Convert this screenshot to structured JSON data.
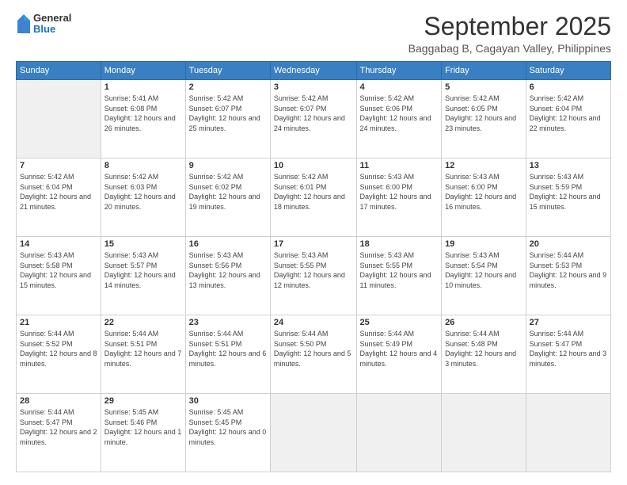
{
  "logo": {
    "general": "General",
    "blue": "Blue"
  },
  "header": {
    "month_title": "September 2025",
    "subtitle": "Baggabag B, Cagayan Valley, Philippines"
  },
  "weekdays": [
    "Sunday",
    "Monday",
    "Tuesday",
    "Wednesday",
    "Thursday",
    "Friday",
    "Saturday"
  ],
  "weeks": [
    [
      {
        "day": "",
        "empty": true
      },
      {
        "day": "1",
        "sunrise": "Sunrise: 5:41 AM",
        "sunset": "Sunset: 6:08 PM",
        "daylight": "Daylight: 12 hours and 26 minutes."
      },
      {
        "day": "2",
        "sunrise": "Sunrise: 5:42 AM",
        "sunset": "Sunset: 6:07 PM",
        "daylight": "Daylight: 12 hours and 25 minutes."
      },
      {
        "day": "3",
        "sunrise": "Sunrise: 5:42 AM",
        "sunset": "Sunset: 6:07 PM",
        "daylight": "Daylight: 12 hours and 24 minutes."
      },
      {
        "day": "4",
        "sunrise": "Sunrise: 5:42 AM",
        "sunset": "Sunset: 6:06 PM",
        "daylight": "Daylight: 12 hours and 24 minutes."
      },
      {
        "day": "5",
        "sunrise": "Sunrise: 5:42 AM",
        "sunset": "Sunset: 6:05 PM",
        "daylight": "Daylight: 12 hours and 23 minutes."
      },
      {
        "day": "6",
        "sunrise": "Sunrise: 5:42 AM",
        "sunset": "Sunset: 6:04 PM",
        "daylight": "Daylight: 12 hours and 22 minutes."
      }
    ],
    [
      {
        "day": "7",
        "sunrise": "Sunrise: 5:42 AM",
        "sunset": "Sunset: 6:04 PM",
        "daylight": "Daylight: 12 hours and 21 minutes."
      },
      {
        "day": "8",
        "sunrise": "Sunrise: 5:42 AM",
        "sunset": "Sunset: 6:03 PM",
        "daylight": "Daylight: 12 hours and 20 minutes."
      },
      {
        "day": "9",
        "sunrise": "Sunrise: 5:42 AM",
        "sunset": "Sunset: 6:02 PM",
        "daylight": "Daylight: 12 hours and 19 minutes."
      },
      {
        "day": "10",
        "sunrise": "Sunrise: 5:42 AM",
        "sunset": "Sunset: 6:01 PM",
        "daylight": "Daylight: 12 hours and 18 minutes."
      },
      {
        "day": "11",
        "sunrise": "Sunrise: 5:43 AM",
        "sunset": "Sunset: 6:00 PM",
        "daylight": "Daylight: 12 hours and 17 minutes."
      },
      {
        "day": "12",
        "sunrise": "Sunrise: 5:43 AM",
        "sunset": "Sunset: 6:00 PM",
        "daylight": "Daylight: 12 hours and 16 minutes."
      },
      {
        "day": "13",
        "sunrise": "Sunrise: 5:43 AM",
        "sunset": "Sunset: 5:59 PM",
        "daylight": "Daylight: 12 hours and 15 minutes."
      }
    ],
    [
      {
        "day": "14",
        "sunrise": "Sunrise: 5:43 AM",
        "sunset": "Sunset: 5:58 PM",
        "daylight": "Daylight: 12 hours and 15 minutes."
      },
      {
        "day": "15",
        "sunrise": "Sunrise: 5:43 AM",
        "sunset": "Sunset: 5:57 PM",
        "daylight": "Daylight: 12 hours and 14 minutes."
      },
      {
        "day": "16",
        "sunrise": "Sunrise: 5:43 AM",
        "sunset": "Sunset: 5:56 PM",
        "daylight": "Daylight: 12 hours and 13 minutes."
      },
      {
        "day": "17",
        "sunrise": "Sunrise: 5:43 AM",
        "sunset": "Sunset: 5:55 PM",
        "daylight": "Daylight: 12 hours and 12 minutes."
      },
      {
        "day": "18",
        "sunrise": "Sunrise: 5:43 AM",
        "sunset": "Sunset: 5:55 PM",
        "daylight": "Daylight: 12 hours and 11 minutes."
      },
      {
        "day": "19",
        "sunrise": "Sunrise: 5:43 AM",
        "sunset": "Sunset: 5:54 PM",
        "daylight": "Daylight: 12 hours and 10 minutes."
      },
      {
        "day": "20",
        "sunrise": "Sunrise: 5:44 AM",
        "sunset": "Sunset: 5:53 PM",
        "daylight": "Daylight: 12 hours and 9 minutes."
      }
    ],
    [
      {
        "day": "21",
        "sunrise": "Sunrise: 5:44 AM",
        "sunset": "Sunset: 5:52 PM",
        "daylight": "Daylight: 12 hours and 8 minutes."
      },
      {
        "day": "22",
        "sunrise": "Sunrise: 5:44 AM",
        "sunset": "Sunset: 5:51 PM",
        "daylight": "Daylight: 12 hours and 7 minutes."
      },
      {
        "day": "23",
        "sunrise": "Sunrise: 5:44 AM",
        "sunset": "Sunset: 5:51 PM",
        "daylight": "Daylight: 12 hours and 6 minutes."
      },
      {
        "day": "24",
        "sunrise": "Sunrise: 5:44 AM",
        "sunset": "Sunset: 5:50 PM",
        "daylight": "Daylight: 12 hours and 5 minutes."
      },
      {
        "day": "25",
        "sunrise": "Sunrise: 5:44 AM",
        "sunset": "Sunset: 5:49 PM",
        "daylight": "Daylight: 12 hours and 4 minutes."
      },
      {
        "day": "26",
        "sunrise": "Sunrise: 5:44 AM",
        "sunset": "Sunset: 5:48 PM",
        "daylight": "Daylight: 12 hours and 3 minutes."
      },
      {
        "day": "27",
        "sunrise": "Sunrise: 5:44 AM",
        "sunset": "Sunset: 5:47 PM",
        "daylight": "Daylight: 12 hours and 3 minutes."
      }
    ],
    [
      {
        "day": "28",
        "sunrise": "Sunrise: 5:44 AM",
        "sunset": "Sunset: 5:47 PM",
        "daylight": "Daylight: 12 hours and 2 minutes."
      },
      {
        "day": "29",
        "sunrise": "Sunrise: 5:45 AM",
        "sunset": "Sunset: 5:46 PM",
        "daylight": "Daylight: 12 hours and 1 minute."
      },
      {
        "day": "30",
        "sunrise": "Sunrise: 5:45 AM",
        "sunset": "Sunset: 5:45 PM",
        "daylight": "Daylight: 12 hours and 0 minutes."
      },
      {
        "day": "",
        "empty": true
      },
      {
        "day": "",
        "empty": true
      },
      {
        "day": "",
        "empty": true
      },
      {
        "day": "",
        "empty": true
      }
    ]
  ]
}
